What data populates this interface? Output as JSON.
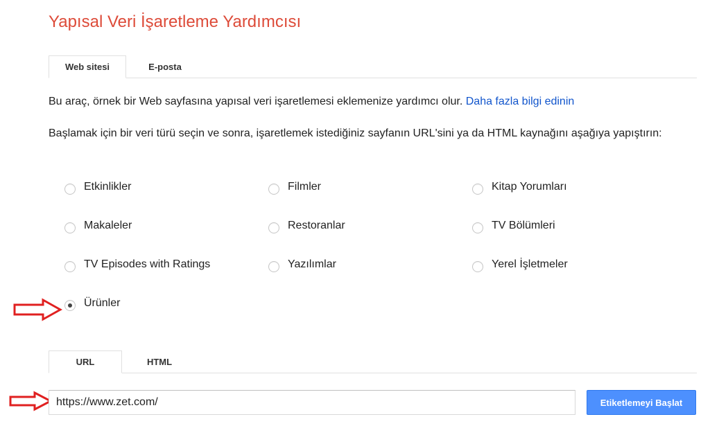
{
  "title": "Yapısal Veri İşaretleme Yardımcısı",
  "top_tabs": [
    {
      "label": "Web sitesi",
      "active": true
    },
    {
      "label": "E-posta",
      "active": false
    }
  ],
  "description": {
    "text": "Bu araç, örnek bir Web sayfasına yapısal veri işaretlemesi eklemenize yardımcı olur. ",
    "link": "Daha fazla bilgi edinin"
  },
  "instructions": "Başlamak için bir veri türü seçin ve sonra, işaretlemek istediğiniz sayfanın URL'sini ya da HTML kaynağını aşağıya yapıştırın:",
  "data_types": [
    {
      "label": "Etkinlikler",
      "checked": false
    },
    {
      "label": "Filmler",
      "checked": false
    },
    {
      "label": "Kitap Yorumları",
      "checked": false
    },
    {
      "label": "Makaleler",
      "checked": false
    },
    {
      "label": "Restoranlar",
      "checked": false
    },
    {
      "label": "TV Bölümleri",
      "checked": false
    },
    {
      "label": "TV Episodes with Ratings",
      "checked": false
    },
    {
      "label": "Yazılımlar",
      "checked": false
    },
    {
      "label": "Yerel İşletmeler",
      "checked": false
    },
    {
      "label": "Ürünler",
      "checked": true
    }
  ],
  "source_tabs": [
    {
      "label": "URL",
      "active": true
    },
    {
      "label": "HTML",
      "active": false
    }
  ],
  "url_input": {
    "value": "https://www.zet.com/"
  },
  "start_button": "Etiketlemeyi Başlat",
  "colors": {
    "title": "#dd4b39",
    "link": "#1155cc",
    "button": "#4d90fe",
    "arrow": "#e02020"
  }
}
